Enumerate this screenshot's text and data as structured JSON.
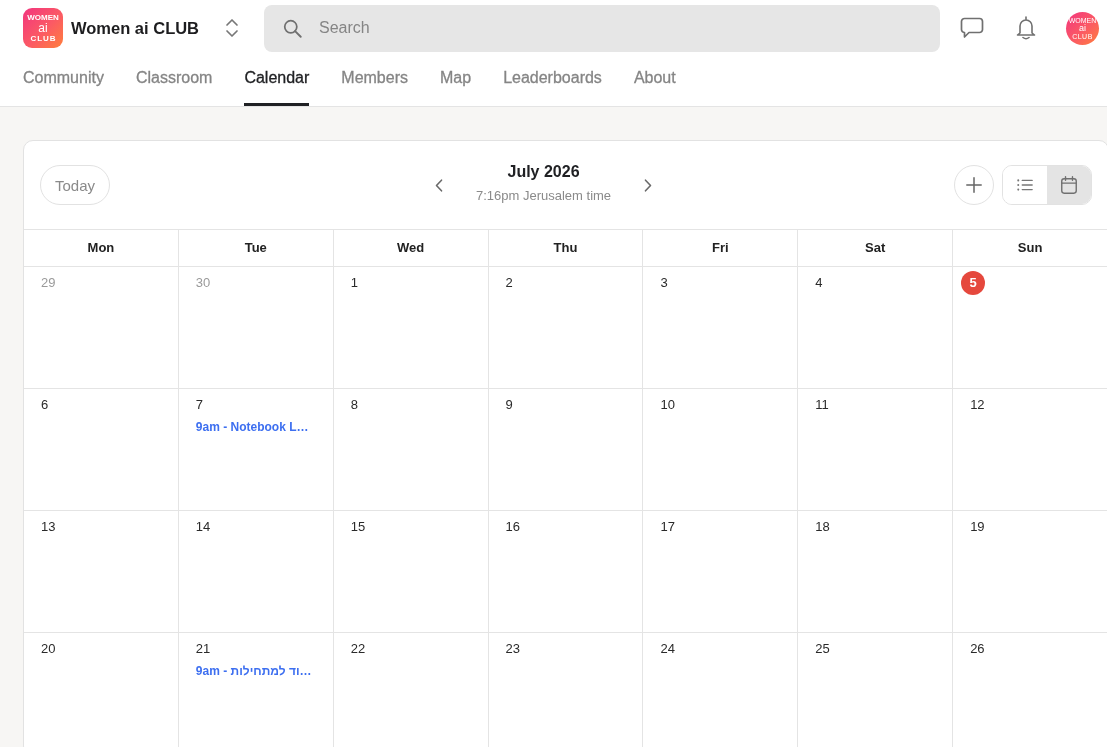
{
  "header": {
    "logo": {
      "line_1": "WOMEN",
      "line_2": "ai",
      "line_3": "CLUB"
    },
    "community_name": "Women ai CLUB",
    "search": {
      "placeholder": "Search"
    },
    "avatar": {
      "line_1": "WOMEN",
      "line_2": "ai",
      "line_3": "CLUB"
    }
  },
  "nav_tabs": [
    {
      "label": "Community",
      "selected": false
    },
    {
      "label": "Classroom",
      "selected": false
    },
    {
      "label": "Calendar",
      "selected": true
    },
    {
      "label": "Members",
      "selected": false
    },
    {
      "label": "Map",
      "selected": false
    },
    {
      "label": "Leaderboards",
      "selected": false
    },
    {
      "label": "About",
      "selected": false
    }
  ],
  "calendar": {
    "today_button": "Today",
    "month_title": "July 2026",
    "timezone": "7:16pm Jerusalem time",
    "view_toggle": [
      {
        "kind": "list",
        "selected": false
      },
      {
        "kind": "month",
        "selected": true
      }
    ],
    "weekdays": [
      "Mon",
      "Tue",
      "Wed",
      "Thu",
      "Fri",
      "Sat",
      "Sun"
    ],
    "weeks": [
      {
        "days": [
          {
            "day": "29",
            "outside_month": true,
            "today": false
          },
          {
            "day": "30",
            "outside_month": true,
            "today": false
          },
          {
            "day": "1",
            "outside_month": false,
            "today": false
          },
          {
            "day": "2",
            "outside_month": false,
            "today": false
          },
          {
            "day": "3",
            "outside_month": false,
            "today": false
          },
          {
            "day": "4",
            "outside_month": false,
            "today": false
          },
          {
            "day": "5",
            "outside_month": false,
            "today": true
          }
        ]
      },
      {
        "days": [
          {
            "day": "6",
            "outside_month": false,
            "today": false
          },
          {
            "day": "7",
            "outside_month": false,
            "today": false,
            "events": [
              {
                "label": "9am - Notebook L…"
              }
            ]
          },
          {
            "day": "8",
            "outside_month": false,
            "today": false
          },
          {
            "day": "9",
            "outside_month": false,
            "today": false
          },
          {
            "day": "10",
            "outside_month": false,
            "today": false
          },
          {
            "day": "11",
            "outside_month": false,
            "today": false
          },
          {
            "day": "12",
            "outside_month": false,
            "today": false
          }
        ]
      },
      {
        "days": [
          {
            "day": "13",
            "outside_month": false,
            "today": false
          },
          {
            "day": "14",
            "outside_month": false,
            "today": false
          },
          {
            "day": "15",
            "outside_month": false,
            "today": false
          },
          {
            "day": "16",
            "outside_month": false,
            "today": false
          },
          {
            "day": "17",
            "outside_month": false,
            "today": false
          },
          {
            "day": "18",
            "outside_month": false,
            "today": false
          },
          {
            "day": "19",
            "outside_month": false,
            "today": false
          }
        ]
      },
      {
        "days": [
          {
            "day": "20",
            "outside_month": false,
            "today": false
          },
          {
            "day": "21",
            "outside_month": false,
            "today": false,
            "events": [
              {
                "label": "9am - וד למתחילות…"
              }
            ]
          },
          {
            "day": "22",
            "outside_month": false,
            "today": false
          },
          {
            "day": "23",
            "outside_month": false,
            "today": false
          },
          {
            "day": "24",
            "outside_month": false,
            "today": false
          },
          {
            "day": "25",
            "outside_month": false,
            "today": false
          },
          {
            "day": "26",
            "outside_month": false,
            "today": false
          }
        ]
      }
    ]
  }
}
